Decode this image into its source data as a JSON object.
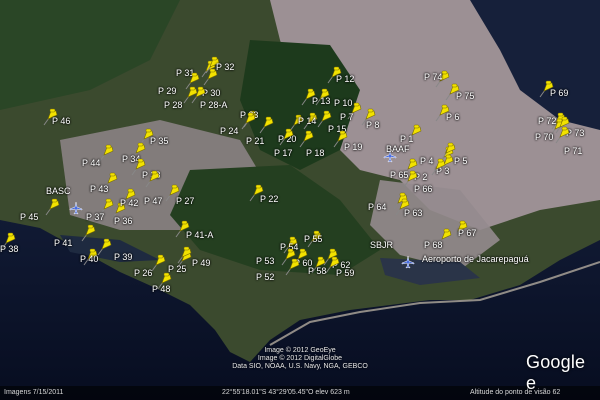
{
  "colors": {
    "ocean": "#0e1a3a",
    "pin": "#f2e200",
    "urban": "#a89a9c",
    "forest": "#1f3a1e"
  },
  "pins": [
    "P 74",
    "P 75",
    "P 6",
    "P 69",
    "P 72",
    "P 70",
    "P 73",
    "P 71",
    "P 31",
    "P 32",
    "P 30",
    "P 29",
    "P 28",
    "P 28-A",
    "P 12",
    "P 10",
    "P 13",
    "P 7",
    "P 8",
    "P 46",
    "P 35",
    "P 23",
    "P 24",
    "P 21",
    "P 20",
    "P 14",
    "P 15",
    "P 17",
    "P 18",
    "P 19",
    "P 1",
    "P 4",
    "P 3",
    "P 2",
    "P 5",
    "P 65",
    "P 66",
    "P 44",
    "P 34",
    "P 33",
    "P 43",
    "P 47",
    "P 27",
    "P 22",
    "P 45",
    "P 37",
    "P 36",
    "P 42",
    "P 41",
    "P 41-A",
    "P 64",
    "P 63",
    "P 67",
    "P 68",
    "P 55",
    "P 54",
    "P 53",
    "P 60",
    "P 62",
    "P 58",
    "P 59",
    "P 52",
    "P 40",
    "P 39",
    "P 26",
    "P 25",
    "P 49",
    "P 48",
    "P 38"
  ],
  "airports": [
    "BASC",
    "BAAF",
    "SBJR",
    "Aeroporto de Jacarepaguá"
  ],
  "credits": {
    "line1": "Image © 2012 GeoEye",
    "line2": "Image © 2012 DigitalGlobe",
    "line3": "Data SIO, NOAA, U.S. Navy, NGA, GEBCO"
  },
  "status": {
    "date": "Imagens 7/15/2011",
    "coords": "22°55'18.01\"S  43°29'05.45\"O  elev  623 m",
    "eye_alt": "Altitude do ponto de visão  62"
  },
  "logo": "Google e"
}
